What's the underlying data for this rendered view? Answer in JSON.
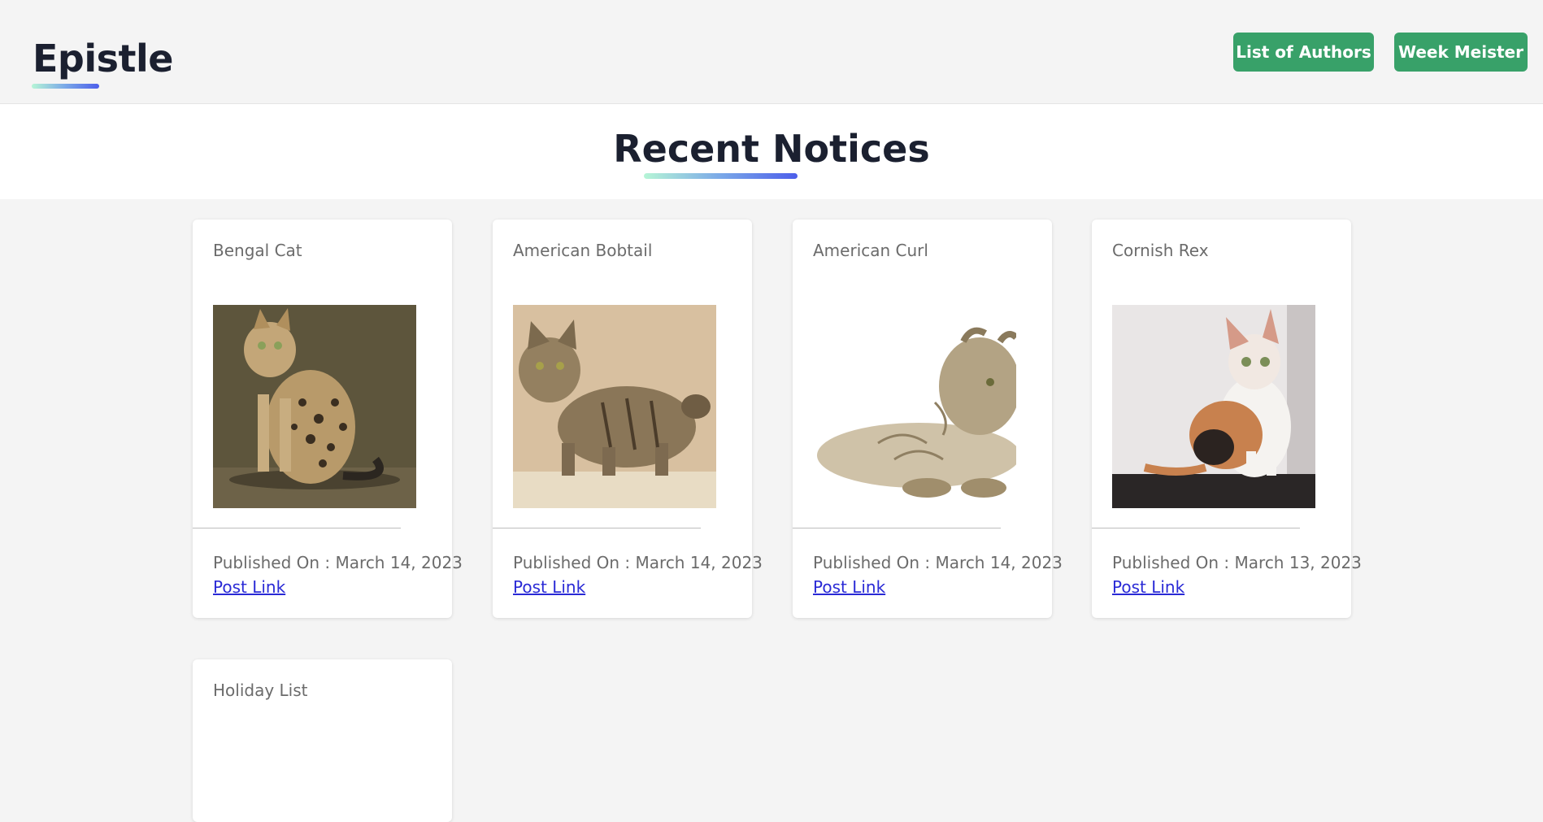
{
  "header": {
    "logo": "Epistle",
    "buttons": {
      "authors": "List of Authors",
      "week": "Week Meister"
    }
  },
  "hero": {
    "title": "Recent Notices"
  },
  "cards": [
    {
      "title": "Bengal Cat",
      "date": "Published On : March 14, 2023",
      "link": "Post Link"
    },
    {
      "title": "American Bobtail",
      "date": "Published On : March 14, 2023",
      "link": "Post Link"
    },
    {
      "title": "American Curl",
      "date": "Published On : March 14, 2023",
      "link": "Post Link"
    },
    {
      "title": "Cornish Rex",
      "date": "Published On : March 13, 2023",
      "link": "Post Link"
    },
    {
      "title": "Holiday List"
    }
  ],
  "colors": {
    "accent_green": "#38a169",
    "link_blue": "#2a2ad6",
    "heading": "#1b2030"
  }
}
